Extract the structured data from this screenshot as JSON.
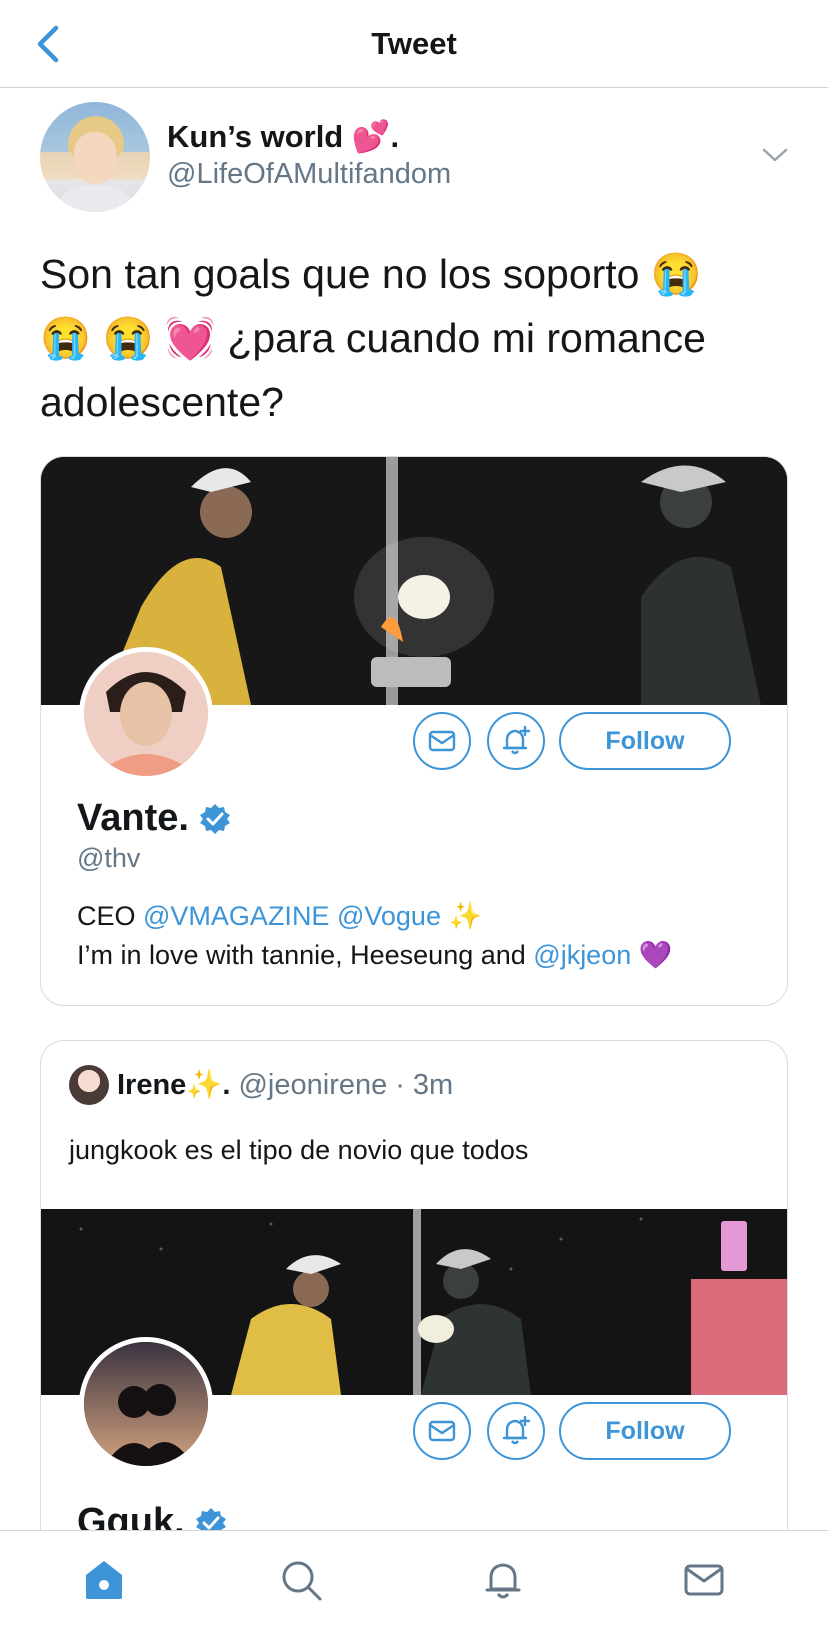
{
  "header": {
    "title": "Tweet"
  },
  "tweet": {
    "author_name": "Kun’s world 💕.",
    "author_handle": "@LifeOfAMultifandom",
    "text": "Son tan goals que no los soporto 😭 😭 😭 💓 ¿para cuando mi romance adolescente?"
  },
  "card1": {
    "display_name": "Vante.",
    "handle": "@thv",
    "follow_label": "Follow",
    "bio_line1_prefix": "CEO ",
    "bio_mention1": "@VMAGAZINE",
    "bio_mention2": "@Vogue",
    "bio_sparkle": "✨",
    "bio_line2_prefix": "I’m in love with tannie, Heeseung and ",
    "bio_mention3": "@jkjeon",
    "bio_heart": "💜"
  },
  "quoted": {
    "name": "Irene✨.",
    "handle": "@jeonirene",
    "separator": "·",
    "time": "3m",
    "text": "jungkook es el tipo de novio que todos",
    "display_name": "Gguk.",
    "follow_label": "Follow"
  },
  "colors": {
    "accent": "#3d95d8",
    "secondary_text": "#657786"
  },
  "icons": [
    "back-chevron-icon",
    "chevron-down-icon",
    "verified-badge-icon",
    "message-icon",
    "bell-plus-icon",
    "home-icon",
    "search-icon",
    "notifications-icon",
    "messages-icon"
  ]
}
